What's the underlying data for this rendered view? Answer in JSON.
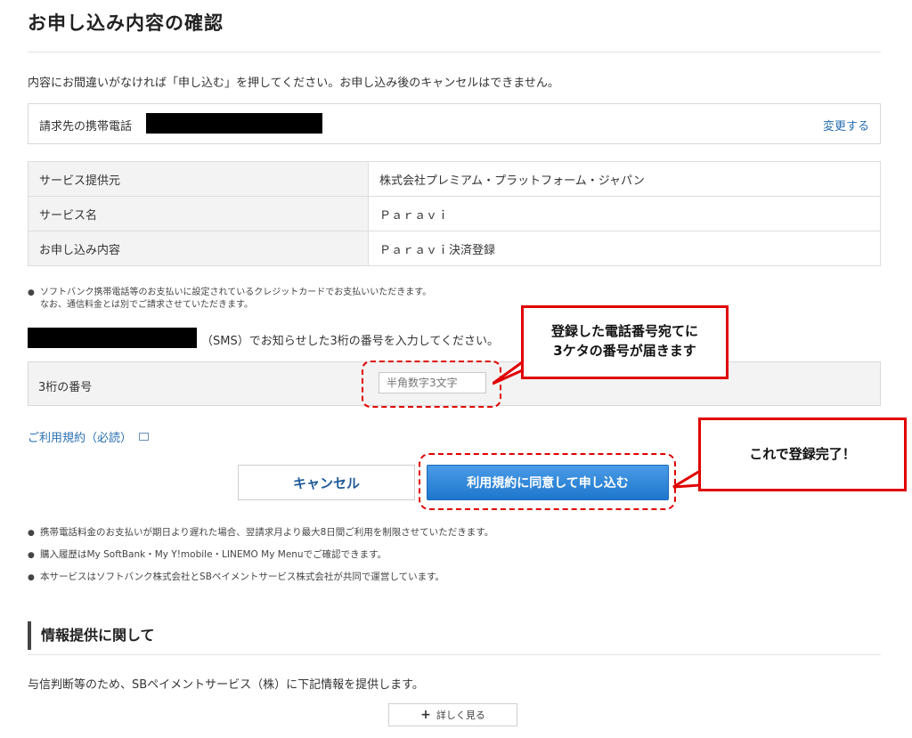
{
  "page": {
    "title": "お申し込み内容の確認",
    "intro": "内容にお間違いがなければ「申し込む」を押してください。お申し込み後のキャンセルはできません。"
  },
  "billing": {
    "label": "請求先の携帯電話",
    "change_link": "変更する"
  },
  "details": [
    {
      "key": "サービス提供元",
      "value": "株式会社プレミアム・プラットフォーム・ジャパン"
    },
    {
      "key": "サービス名",
      "value": "Ｐａｒａｖｉ"
    },
    {
      "key": "お申し込み内容",
      "value": "Ｐａｒａｖｉ決済登録"
    }
  ],
  "payment_note": {
    "line1": "ソフトバンク携帯電話等のお支払いに設定されているクレジットカードでお支払いいただきます。",
    "line2": "なお、通信料金とは別でご請求させていただきます。"
  },
  "sms": {
    "text": "（SMS）でお知らせした3桁の番号を入力してください。",
    "code_label": "3桁の番号",
    "code_placeholder": "半角数字3文字"
  },
  "callouts": {
    "code_line1": "登録した電話番号宛てに",
    "code_line2": "3ケタの番号が届きます",
    "apply": "これで登録完了！"
  },
  "terms_link": "ご利用規約（必読）",
  "buttons": {
    "cancel": "キャンセル",
    "apply": "利用規約に同意して申し込む"
  },
  "notes": [
    "携帯電話料金のお支払いが期日より遅れた場合、翌請求月より最大8日間ご利用を制限させていただきます。",
    "購入履歴はMy SoftBank・My Y!mobile・LINEMO My Menuでご確認できます。",
    "本サービスはソフトバンク株式会社とSBペイメントサービス株式会社が共同で運営しています。"
  ],
  "info_section": {
    "heading": "情報提供に関して",
    "text": "与信判断等のため、SBペイメントサービス（株）に下記情報を提供します。",
    "more_button": "詳しく見る"
  },
  "colors": {
    "link": "#2a6fb0",
    "primary_button": "#2a84d8",
    "annotation": "#e00000"
  }
}
